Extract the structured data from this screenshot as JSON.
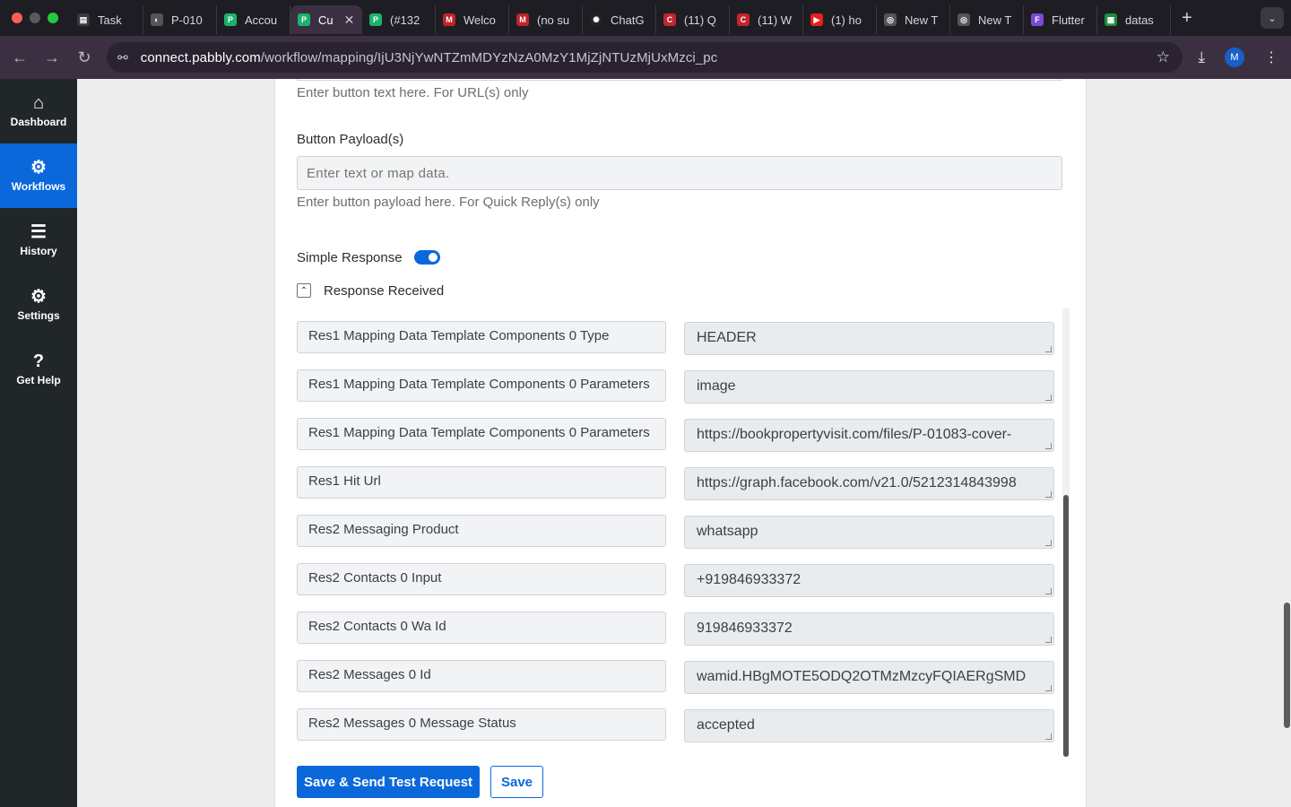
{
  "browser": {
    "tabs": [
      {
        "label": "Task",
        "fav_color": "#3a3840",
        "fav_glyph": "▤"
      },
      {
        "label": "P-010",
        "fav_color": "#555",
        "fav_glyph": "◐"
      },
      {
        "label": "Accou",
        "fav_color": "#1bb36b",
        "fav_glyph": "P"
      },
      {
        "label": "Cu",
        "fav_color": "#1bb36b",
        "fav_glyph": "P",
        "active": true
      },
      {
        "label": "(#132",
        "fav_color": "#1bb36b",
        "fav_glyph": "P"
      },
      {
        "label": "Welco",
        "fav_color": "#c0232b",
        "fav_glyph": "M"
      },
      {
        "label": "(no su",
        "fav_color": "#c0232b",
        "fav_glyph": "M"
      },
      {
        "label": "ChatG",
        "fav_color": "#222",
        "fav_glyph": "✺"
      },
      {
        "label": "(11) Q",
        "fav_color": "#c3252c",
        "fav_glyph": "C"
      },
      {
        "label": "(11) W",
        "fav_color": "#c3252c",
        "fav_glyph": "C"
      },
      {
        "label": "(1) ho",
        "fav_color": "#e62117",
        "fav_glyph": "▶"
      },
      {
        "label": "New T",
        "fav_color": "#555",
        "fav_glyph": "◎"
      },
      {
        "label": "New T",
        "fav_color": "#555",
        "fav_glyph": "◎"
      },
      {
        "label": "Flutter",
        "fav_color": "#7a4ad8",
        "fav_glyph": "F"
      },
      {
        "label": "datas",
        "fav_color": "#1e8e3e",
        "fav_glyph": "▦"
      }
    ],
    "url_host": "connect.pabbly.com",
    "url_path": "/workflow/mapping/IjU3NjYwNTZmMDYzNzA0MzY1MjZjNTUzMjUxMzci_pc",
    "avatar_letter": "M"
  },
  "sidebar": {
    "items": [
      {
        "label": "Dashboard",
        "icon": "⌂"
      },
      {
        "label": "Workflows",
        "icon": "⚙"
      },
      {
        "label": "History",
        "icon": "☰"
      },
      {
        "label": "Settings",
        "icon": "⚙"
      },
      {
        "label": "Get Help",
        "icon": "?"
      }
    ]
  },
  "form": {
    "button_text_help": "Enter button text here.  For URL(s) only",
    "payload_label": "Button Payload(s)",
    "payload_placeholder": "Enter text or map data.",
    "payload_help": "Enter button payload here. For Quick Reply(s) only",
    "simple_response_label": "Simple Response",
    "simple_response_on": true,
    "response_received_label": "Response Received",
    "rows": [
      {
        "key": "Res1 Mapping Data Template Components 0 Type",
        "value": "HEADER"
      },
      {
        "key": "Res1 Mapping Data Template Components 0 Parameters",
        "value": "image"
      },
      {
        "key": "Res1 Mapping Data Template Components 0 Parameters",
        "value": "https://bookpropertyvisit.com/files/P-01083-cover-"
      },
      {
        "key": "Res1 Hit Url",
        "value": "https://graph.facebook.com/v21.0/5212314843998"
      },
      {
        "key": "Res2 Messaging Product",
        "value": "whatsapp"
      },
      {
        "key": "Res2 Contacts 0 Input",
        "value": "+919846933372"
      },
      {
        "key": "Res2 Contacts 0 Wa Id",
        "value": "919846933372"
      },
      {
        "key": "Res2 Messages 0 Id",
        "value": "wamid.HBgMOTE5ODQ2OTMzMzcyFQIAERgSMD"
      },
      {
        "key": "Res2 Messages 0 Message Status",
        "value": "accepted"
      }
    ],
    "save_send_label": "Save & Send Test Request",
    "save_label": "Save"
  }
}
